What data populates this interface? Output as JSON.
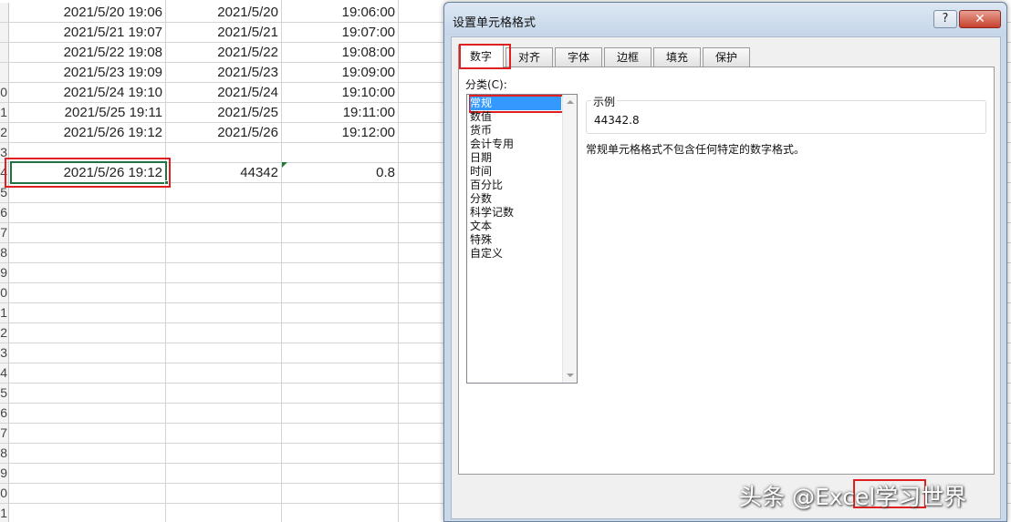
{
  "sheet": {
    "rows": [
      {
        "num": "",
        "datetime": "2021/5/20 19:06",
        "date": "2021/5/20",
        "time": "19:06:00"
      },
      {
        "num": "",
        "datetime": "2021/5/21 19:07",
        "date": "2021/5/21",
        "time": "19:07:00"
      },
      {
        "num": "",
        "datetime": "2021/5/22 19:08",
        "date": "2021/5/22",
        "time": "19:08:00"
      },
      {
        "num": "",
        "datetime": "2021/5/23 19:09",
        "date": "2021/5/23",
        "time": "19:09:00"
      },
      {
        "num": "0",
        "datetime": "2021/5/24 19:10",
        "date": "2021/5/24",
        "time": "19:10:00"
      },
      {
        "num": "1",
        "datetime": "2021/5/25 19:11",
        "date": "2021/5/25",
        "time": "19:11:00"
      },
      {
        "num": "2",
        "datetime": "2021/5/26 19:12",
        "date": "2021/5/26",
        "time": "19:12:00"
      },
      {
        "num": "3",
        "datetime": "",
        "date": "",
        "time": ""
      },
      {
        "num": "4",
        "datetime": "2021/5/26 19:12",
        "date": "44342",
        "time": "0.8"
      },
      {
        "num": "5",
        "datetime": "",
        "date": "",
        "time": ""
      },
      {
        "num": "6",
        "datetime": "",
        "date": "",
        "time": ""
      },
      {
        "num": "7",
        "datetime": "",
        "date": "",
        "time": ""
      },
      {
        "num": "8",
        "datetime": "",
        "date": "",
        "time": ""
      },
      {
        "num": "9",
        "datetime": "",
        "date": "",
        "time": ""
      },
      {
        "num": "0",
        "datetime": "",
        "date": "",
        "time": ""
      },
      {
        "num": "1",
        "datetime": "",
        "date": "",
        "time": ""
      },
      {
        "num": "2",
        "datetime": "",
        "date": "",
        "time": ""
      },
      {
        "num": "3",
        "datetime": "",
        "date": "",
        "time": ""
      },
      {
        "num": "4",
        "datetime": "",
        "date": "",
        "time": ""
      },
      {
        "num": "5",
        "datetime": "",
        "date": "",
        "time": ""
      },
      {
        "num": "6",
        "datetime": "",
        "date": "",
        "time": ""
      },
      {
        "num": "7",
        "datetime": "",
        "date": "",
        "time": ""
      },
      {
        "num": "8",
        "datetime": "",
        "date": "",
        "time": ""
      },
      {
        "num": "9",
        "datetime": "",
        "date": "",
        "time": ""
      },
      {
        "num": "0",
        "datetime": "",
        "date": "",
        "time": ""
      },
      {
        "num": "1",
        "datetime": "",
        "date": "",
        "time": ""
      }
    ]
  },
  "dialog": {
    "title": "设置单元格格式",
    "help_label": "?",
    "close_label": "✕",
    "tabs": [
      "数字",
      "对齐",
      "字体",
      "边框",
      "填充",
      "保护"
    ],
    "category_label": "分类(C):",
    "categories": [
      "常规",
      "数值",
      "货币",
      "会计专用",
      "日期",
      "时间",
      "百分比",
      "分数",
      "科学记数",
      "文本",
      "特殊",
      "自定义"
    ],
    "selected_category": "常规",
    "sample_label": "示例",
    "sample_value": "44342.8",
    "description": "常规单元格格式不包含任何特定的数字格式。"
  },
  "watermark": "头条 @Excel学习世界",
  "colors": {
    "highlight_red": "#e02020",
    "selection_blue": "#3399ff",
    "active_cell_green": "#217346"
  }
}
